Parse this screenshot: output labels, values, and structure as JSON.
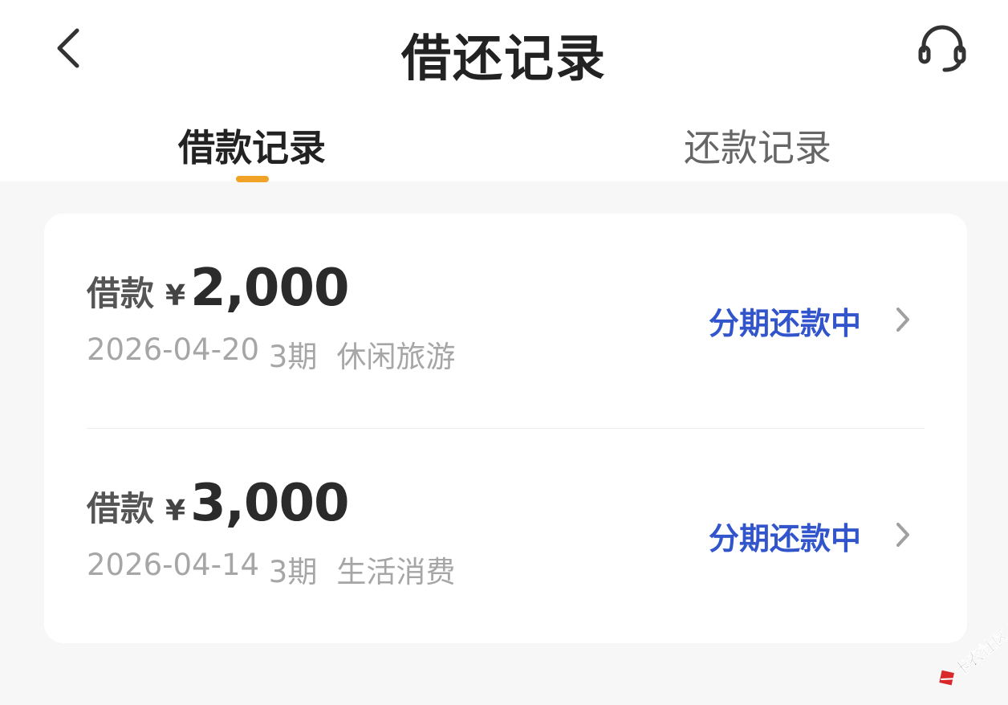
{
  "header": {
    "title": "借还记录",
    "back_icon": "chevron-left-icon",
    "service_icon": "headset-icon"
  },
  "tabs": [
    {
      "label": "借款记录",
      "active": true
    },
    {
      "label": "还款记录",
      "active": false
    }
  ],
  "colors": {
    "accent": "#f0a326",
    "status": "#3355cc",
    "background": "#f7f7f7"
  },
  "records": [
    {
      "label": "借款",
      "currency": "¥",
      "amount": "2,000",
      "date": "2026-04-20",
      "periods": "3期",
      "purpose": "休闲旅游",
      "status": "分期还款中"
    },
    {
      "label": "借款",
      "currency": "¥",
      "amount": "3,000",
      "date": "2026-04-14",
      "periods": "3期",
      "purpose": "生活消费",
      "status": "分期还款中"
    }
  ],
  "watermark": {
    "text": "卡农社区"
  }
}
